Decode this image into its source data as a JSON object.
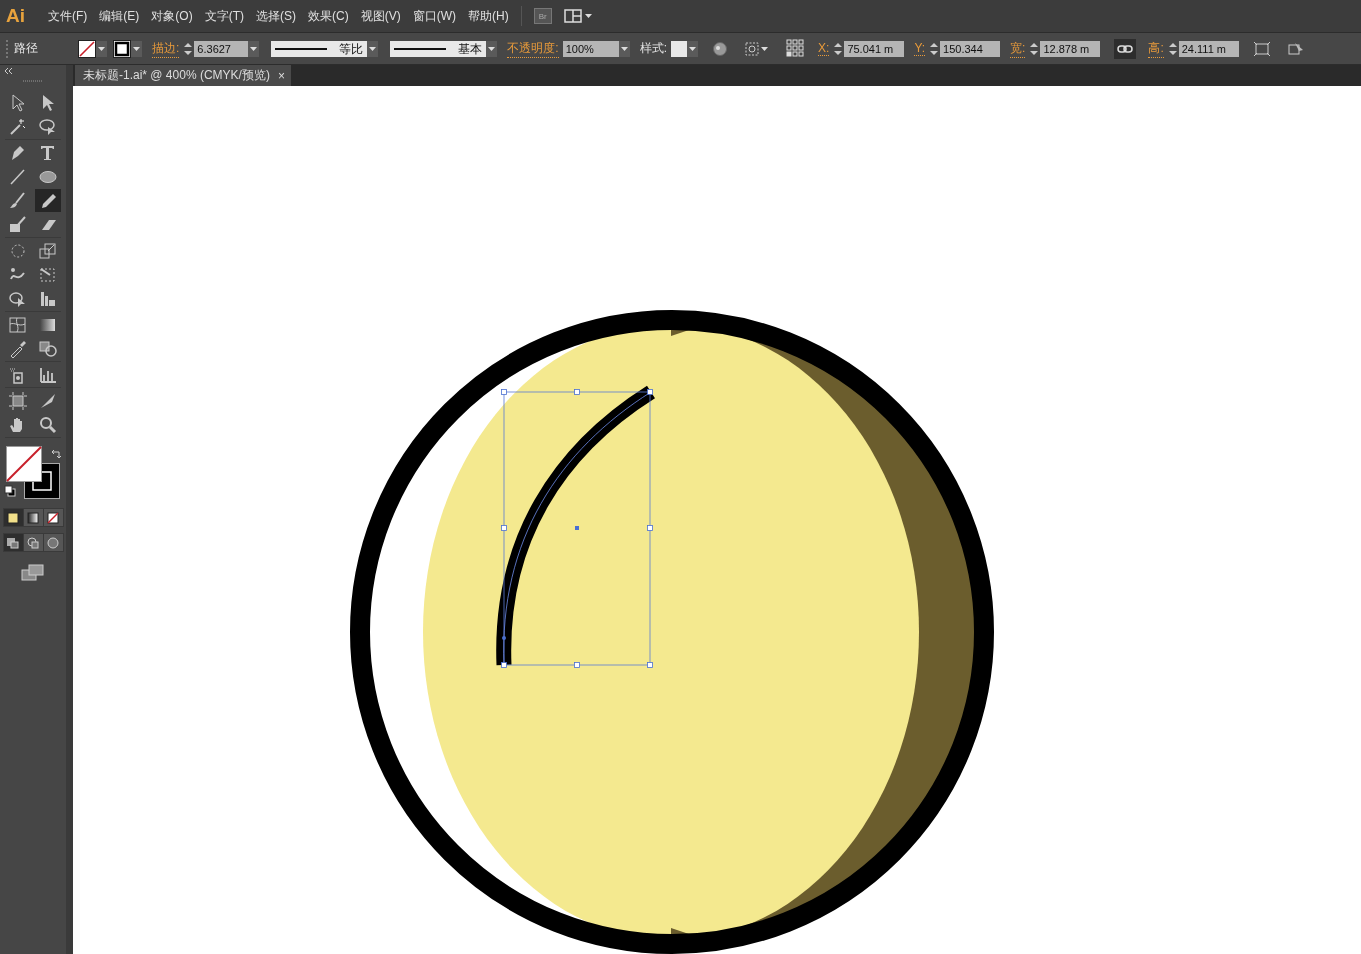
{
  "menu_bar": {
    "logo": "Ai",
    "menus": [
      "文件(F)",
      "编辑(E)",
      "对象(O)",
      "文字(T)",
      "选择(S)",
      "效果(C)",
      "视图(V)",
      "窗口(W)",
      "帮助(H)"
    ],
    "bridge": "Br"
  },
  "control_bar": {
    "selection_label": "路径",
    "stroke_label": "描边:",
    "stroke_weight": "6.3627",
    "variable_width": "等比",
    "brush": "基本",
    "opacity_label": "不透明度:",
    "opacity": "100%",
    "style_label": "样式:",
    "transform": [
      {
        "label": "X:",
        "value": "75.041 m"
      },
      {
        "label": "Y:",
        "value": "150.344"
      },
      {
        "label": "宽:",
        "value": "12.878 m"
      },
      {
        "label": "高:",
        "value": "24.111 m"
      }
    ]
  },
  "document_tab": {
    "title": "未标题-1.ai* @ 400% (CMYK/预览)",
    "close": "×"
  },
  "tools": [
    {
      "selected": false
    },
    {
      "selected": false
    },
    {
      "selected": false
    },
    {
      "selected": false
    },
    {
      "selected": false
    },
    {
      "selected": false
    },
    {
      "selected": false
    },
    {
      "selected": false
    },
    {
      "selected": false
    },
    {
      "selected": true
    },
    {
      "selected": false
    },
    {
      "selected": false
    },
    {
      "selected": false
    },
    {
      "selected": false
    },
    {
      "selected": false
    },
    {
      "selected": false
    },
    {
      "selected": false
    },
    {
      "selected": false
    },
    {
      "selected": false
    },
    {
      "selected": false
    },
    {
      "selected": false
    },
    {
      "selected": false
    },
    {
      "selected": false
    },
    {
      "selected": false
    },
    {
      "selected": false
    },
    {
      "selected": false
    },
    {
      "selected": false
    },
    {
      "selected": false
    }
  ],
  "color_modes": [
    {
      "selected": true
    },
    {
      "selected": false
    },
    {
      "selected": false
    }
  ],
  "draw_modes": [
    {
      "selected": true
    },
    {
      "selected": false
    },
    {
      "selected": false
    }
  ]
}
